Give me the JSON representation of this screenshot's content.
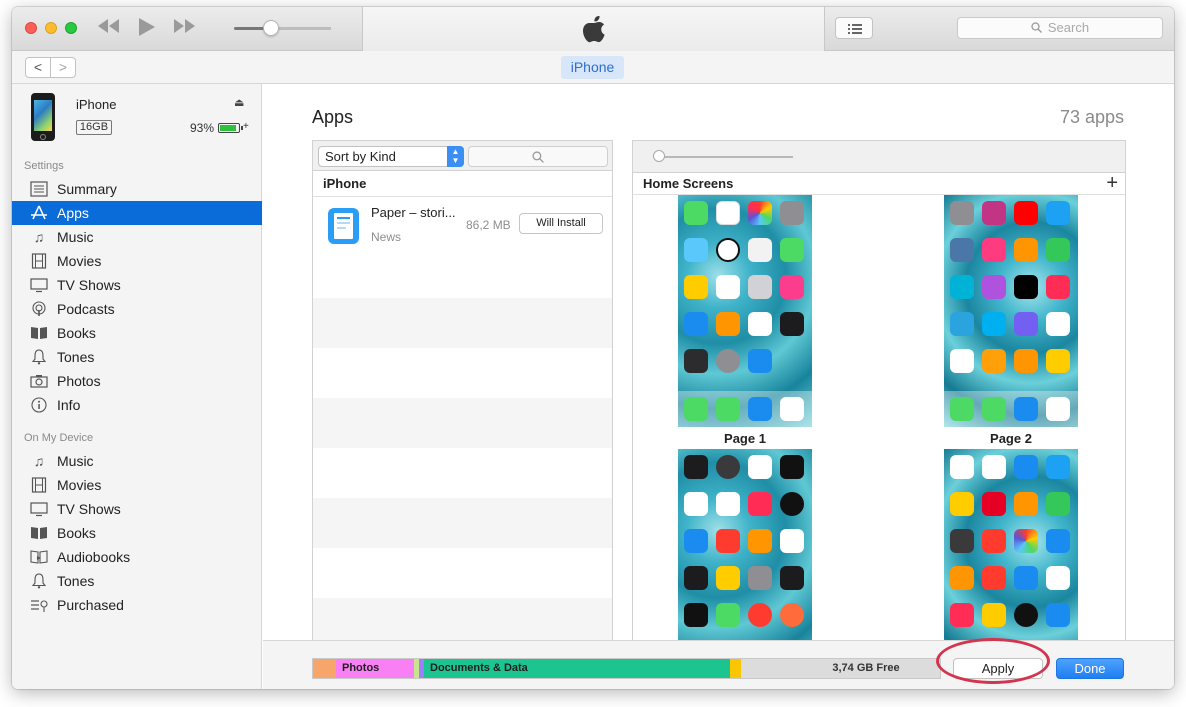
{
  "toolbar": {
    "rewind_icon": "rewind-icon",
    "play_icon": "play-icon",
    "fastforward_icon": "fast-forward-icon",
    "volume_level": 0.38,
    "search_placeholder": "Search"
  },
  "nav": {
    "back": "<",
    "forward": ">",
    "device_tab": "iPhone"
  },
  "device": {
    "name": "iPhone",
    "capacity": "16GB",
    "battery": "93%",
    "eject": "⏏",
    "charging": "+"
  },
  "sidebar": {
    "settings_header": "Settings",
    "settings_items": [
      {
        "label": "Summary",
        "icon": "summary-icon"
      },
      {
        "label": "Apps",
        "icon": "apps-icon"
      },
      {
        "label": "Music",
        "icon": "music-icon"
      },
      {
        "label": "Movies",
        "icon": "movies-icon"
      },
      {
        "label": "TV Shows",
        "icon": "tv-icon"
      },
      {
        "label": "Podcasts",
        "icon": "podcasts-icon"
      },
      {
        "label": "Books",
        "icon": "books-icon"
      },
      {
        "label": "Tones",
        "icon": "bell-icon"
      },
      {
        "label": "Photos",
        "icon": "camera-icon"
      },
      {
        "label": "Info",
        "icon": "info-icon"
      }
    ],
    "device_header": "On My Device",
    "device_items": [
      {
        "label": "Music",
        "icon": "music-icon"
      },
      {
        "label": "Movies",
        "icon": "movies-icon"
      },
      {
        "label": "TV Shows",
        "icon": "tv-icon"
      },
      {
        "label": "Books",
        "icon": "books-icon"
      },
      {
        "label": "Audiobooks",
        "icon": "audiobooks-icon"
      },
      {
        "label": "Tones",
        "icon": "bell-icon"
      },
      {
        "label": "Purchased",
        "icon": "purchased-icon"
      }
    ]
  },
  "main": {
    "title": "Apps",
    "count": "73 apps",
    "sort_label": "Sort by Kind",
    "group_header": "iPhone",
    "app": {
      "name": "Paper – stori...",
      "category": "News",
      "size": "86,2 MB",
      "action": "Will Install"
    },
    "home_screens_label": "Home Screens",
    "add_screen": "+",
    "page1_label": "Page 1",
    "page2_label": "Page 2"
  },
  "storage": {
    "photos_label": "Photos",
    "docs_label": "Documents & Data",
    "free_label": "3,74 GB Free",
    "colors": {
      "other": "#f7a56a",
      "photos": "#f97ff5",
      "apps": "#9b7fff",
      "docs": "#1cc490",
      "yellow": "#f9c600",
      "free": "#dcdcdc"
    }
  },
  "actions": {
    "apply": "Apply",
    "done": "Done"
  }
}
